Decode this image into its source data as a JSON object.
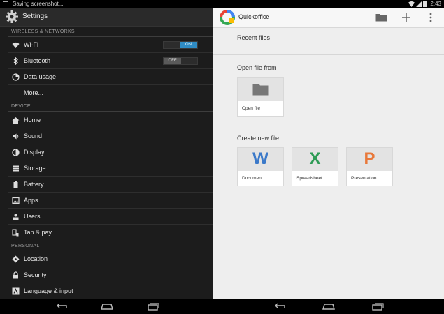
{
  "left": {
    "status_text": "Saving screenshot...",
    "header_title": "Settings",
    "sections": {
      "wireless": "WIRELESS & NETWORKS",
      "device": "DEVICE",
      "personal": "PERSONAL"
    },
    "wireless_items": [
      {
        "label": "Wi-Fi",
        "icon": "wifi-icon",
        "toggle": "ON"
      },
      {
        "label": "Bluetooth",
        "icon": "bluetooth-icon",
        "toggle": "OFF"
      },
      {
        "label": "Data usage",
        "icon": "data-usage-icon"
      },
      {
        "label": "More..."
      }
    ],
    "device_items": [
      {
        "label": "Home",
        "icon": "home-icon"
      },
      {
        "label": "Sound",
        "icon": "sound-icon"
      },
      {
        "label": "Display",
        "icon": "display-icon"
      },
      {
        "label": "Storage",
        "icon": "storage-icon"
      },
      {
        "label": "Battery",
        "icon": "battery-icon"
      },
      {
        "label": "Apps",
        "icon": "apps-icon"
      },
      {
        "label": "Users",
        "icon": "users-icon"
      },
      {
        "label": "Tap & pay",
        "icon": "tap-pay-icon"
      }
    ],
    "personal_items": [
      {
        "label": "Location",
        "icon": "location-icon"
      },
      {
        "label": "Security",
        "icon": "security-icon"
      },
      {
        "label": "Language & input",
        "icon": "language-icon"
      }
    ]
  },
  "right": {
    "status_time": "2:43",
    "app_title": "Quickoffice",
    "recent_files": "Recent files",
    "open_file_from": "Open file from",
    "open_file_card": "Open file",
    "create_new_file": "Create new file",
    "new_cards": [
      {
        "label": "Document",
        "letter": "W",
        "color": "#3b79c9"
      },
      {
        "label": "Spreadsheet",
        "letter": "X",
        "color": "#2e9b55"
      },
      {
        "label": "Presentation",
        "letter": "P",
        "color": "#e8783a"
      }
    ]
  },
  "colors": {
    "toggle_on": "#2f8cc4",
    "settings_bg": "#1c1c1c",
    "office_bg": "#eeeeee"
  }
}
